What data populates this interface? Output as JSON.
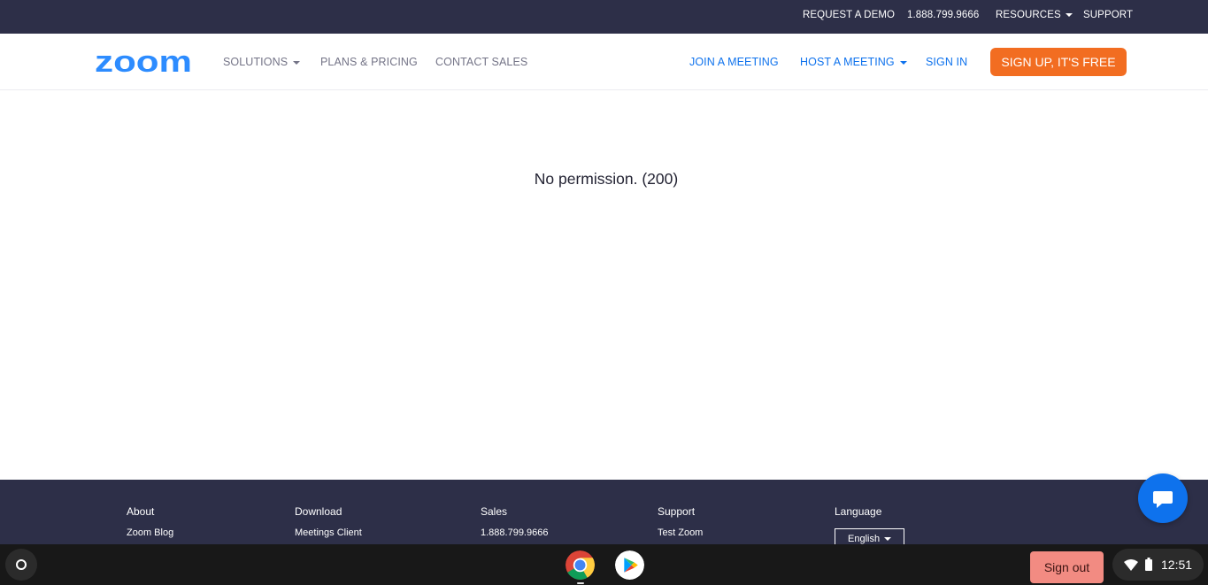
{
  "topbar": {
    "request_demo": "REQUEST A DEMO",
    "phone": "1.888.799.9666",
    "resources": "RESOURCES",
    "support": "SUPPORT"
  },
  "nav": {
    "logo_text": "zoom",
    "solutions": "SOLUTIONS",
    "plans": "PLANS & PRICING",
    "contact_sales": "CONTACT SALES",
    "join": "JOIN A MEETING",
    "host": "HOST A MEETING",
    "sign_in": "SIGN IN",
    "sign_up": "SIGN UP, IT'S FREE"
  },
  "main": {
    "message": "No permission. (200)"
  },
  "footer": {
    "about": {
      "heading": "About",
      "link": "Zoom Blog"
    },
    "download": {
      "heading": "Download",
      "link": "Meetings Client"
    },
    "sales": {
      "heading": "Sales",
      "link": "1.888.799.9666"
    },
    "support": {
      "heading": "Support",
      "link": "Test Zoom"
    },
    "language": {
      "heading": "Language",
      "selected": "English"
    }
  },
  "shelf": {
    "sign_out": "Sign out",
    "time": "12:51"
  },
  "colors": {
    "brand_blue": "#0e72ed",
    "signup_orange": "#f26d21",
    "dark_bar": "#2d2f48",
    "signout_pink": "#f28b82"
  },
  "icons": [
    "chevron-down-icon",
    "chat-icon",
    "launcher-icon",
    "chrome-icon",
    "play-store-icon",
    "wifi-icon",
    "battery-icon"
  ]
}
